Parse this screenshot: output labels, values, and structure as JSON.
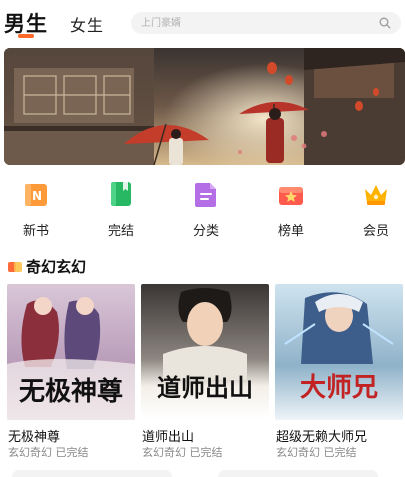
{
  "header": {
    "tabs": [
      {
        "label": "男生",
        "active": true
      },
      {
        "label": "女生",
        "active": false
      }
    ],
    "search": {
      "placeholder": "上门豪婿"
    }
  },
  "quick_nav": [
    {
      "label": "新书",
      "icon": "new-book-icon",
      "color": "#ff8c2b",
      "badge": "N"
    },
    {
      "label": "完结",
      "icon": "finished-book-icon",
      "color": "#2bc06a"
    },
    {
      "label": "分类",
      "icon": "category-icon",
      "color": "#b06ee0"
    },
    {
      "label": "榜单",
      "icon": "ranking-icon",
      "color": "#ff5a52"
    },
    {
      "label": "会员",
      "icon": "vip-crown-icon",
      "color": "#ffb300"
    }
  ],
  "section": {
    "title": "奇幻玄幻"
  },
  "books": [
    {
      "title": "无极神尊",
      "meta": "玄幻奇幻 已完结",
      "cover_text": "无极神尊"
    },
    {
      "title": "道师出山",
      "meta": "玄幻奇幻 已完结",
      "cover_text": "道师出山"
    },
    {
      "title": "超级无赖大师兄",
      "meta": "玄幻奇幻 已完结",
      "cover_text": "大师兄"
    }
  ],
  "colors": {
    "accent": "#ff6a2b"
  }
}
